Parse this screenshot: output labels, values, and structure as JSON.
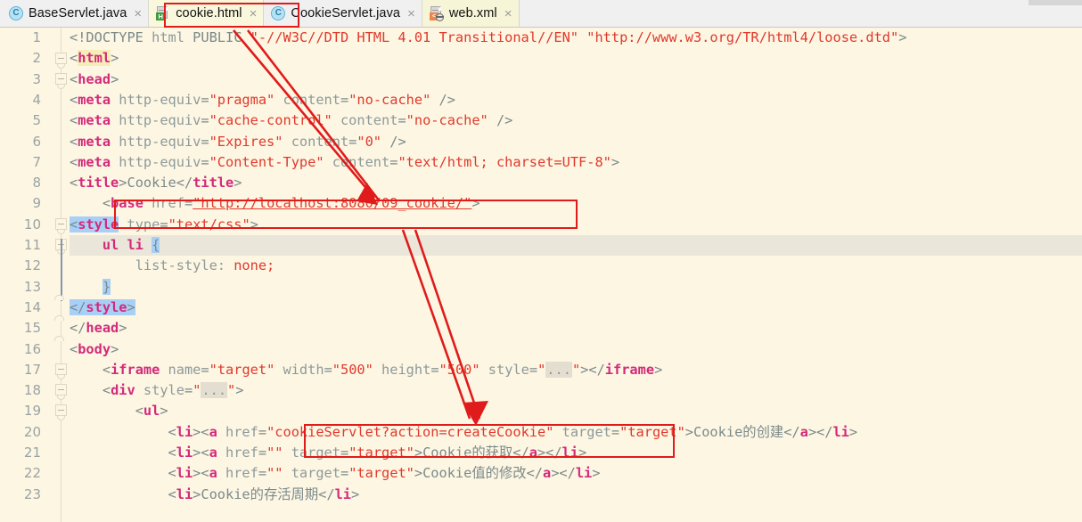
{
  "window": {
    "type": "code-editor",
    "theme_background": "#fdf6e3",
    "accent_annotation_color": "#e01b1b"
  },
  "tabs": [
    {
      "label": "BaseServlet.java",
      "icon": "java-class-icon",
      "close_glyph": "×",
      "active": false
    },
    {
      "label": "cookie.html",
      "icon": "html-file-icon",
      "close_glyph": "×",
      "active": true
    },
    {
      "label": "CookieServlet.java",
      "icon": "java-class-icon",
      "close_glyph": "×",
      "active": false
    },
    {
      "label": "web.xml",
      "icon": "xml-file-icon",
      "close_glyph": "×",
      "active": false
    }
  ],
  "editor": {
    "current_line": 11,
    "first_line": 1,
    "last_line": 23,
    "line_numbers": [
      "1",
      "2",
      "3",
      "4",
      "5",
      "6",
      "7",
      "8",
      "9",
      "10",
      "11",
      "12",
      "13",
      "14",
      "15",
      "16",
      "17",
      "18",
      "19",
      "20",
      "21",
      "22",
      "23"
    ],
    "lines": [
      {
        "n": 1,
        "text": "<!DOCTYPE html PUBLIC \"-//W3C//DTD HTML 4.01 Transitional//EN\" \"http://www.w3.org/TR/html4/loose.dtd\">"
      },
      {
        "n": 2,
        "text": "<html>"
      },
      {
        "n": 3,
        "text": "<head>"
      },
      {
        "n": 4,
        "text": "<meta http-equiv=\"pragma\" content=\"no-cache\" />"
      },
      {
        "n": 5,
        "text": "<meta http-equiv=\"cache-control\" content=\"no-cache\" />"
      },
      {
        "n": 6,
        "text": "<meta http-equiv=\"Expires\" content=\"0\" />"
      },
      {
        "n": 7,
        "text": "<meta http-equiv=\"Content-Type\" content=\"text/html; charset=UTF-8\">"
      },
      {
        "n": 8,
        "text": "<title>Cookie</title>"
      },
      {
        "n": 9,
        "text": "    <base href=\"http://localhost:8080/09_cookie/\">"
      },
      {
        "n": 10,
        "text": "<style type=\"text/css\">"
      },
      {
        "n": 11,
        "text": "    ul li {"
      },
      {
        "n": 12,
        "text": "        list-style: none;"
      },
      {
        "n": 13,
        "text": "    }"
      },
      {
        "n": 14,
        "text": "</style>"
      },
      {
        "n": 15,
        "text": "</head>"
      },
      {
        "n": 16,
        "text": "<body>"
      },
      {
        "n": 17,
        "text": "    <iframe name=\"target\" width=\"500\" height=\"500\" style=\"...\"></iframe>"
      },
      {
        "n": 18,
        "text": "    <div style=\"...\">"
      },
      {
        "n": 19,
        "text": "        <ul>"
      },
      {
        "n": 20,
        "text": "            <li><a href=\"cookieServlet?action=createCookie\" target=\"target\">Cookie的创建</a></li>"
      },
      {
        "n": 21,
        "text": "            <li><a href=\"\" target=\"target\">Cookie的获取</a></li>"
      },
      {
        "n": 22,
        "text": "            <li><a href=\"\" target=\"target\">Cookie值的修改</a></li>"
      },
      {
        "n": 23,
        "text": "            <li>Cookie的存活周期</li>"
      }
    ],
    "fold_ellipsis": "...",
    "tokens": {
      "doctype_keyword": "<!DOCTYPE",
      "doctype_name": "html",
      "doctype_public": "PUBLIC",
      "doctype_fpi": "\"-//W3C//DTD HTML 4.01 Transitional//EN\"",
      "doctype_url": "\"http://www.w3.org/TR/html4/loose.dtd\"",
      "base_url": "http://localhost:8080/09_cookie/",
      "link_href_value": "cookieServlet?action=createCookie"
    }
  },
  "annotations": {
    "boxes": [
      {
        "name": "tab-highlight-box",
        "target": "cookie.html tab"
      },
      {
        "name": "base-href-box",
        "target": "line 9 base href"
      },
      {
        "name": "cookie-servlet-href-box",
        "target": "line 20 anchor href"
      }
    ],
    "arrows": [
      {
        "name": "arrow-tab-to-base",
        "from": "cookie.html tab",
        "to": "line 9 base tag"
      },
      {
        "name": "arrow-base-to-servlet-url",
        "from": "line 9 base href",
        "to": "line 20 href value"
      }
    ]
  },
  "colors": {
    "background": "#fdf6e3",
    "tag": "#d32a7a",
    "string": "#e0392c",
    "attribute": "#8d9a9a",
    "line_number": "#9aa3a3",
    "current_line": "#eae6da",
    "bracket_match": "#a8d0f7",
    "annotation_red": "#e01b1b",
    "tab_active": "#faf8dc"
  }
}
